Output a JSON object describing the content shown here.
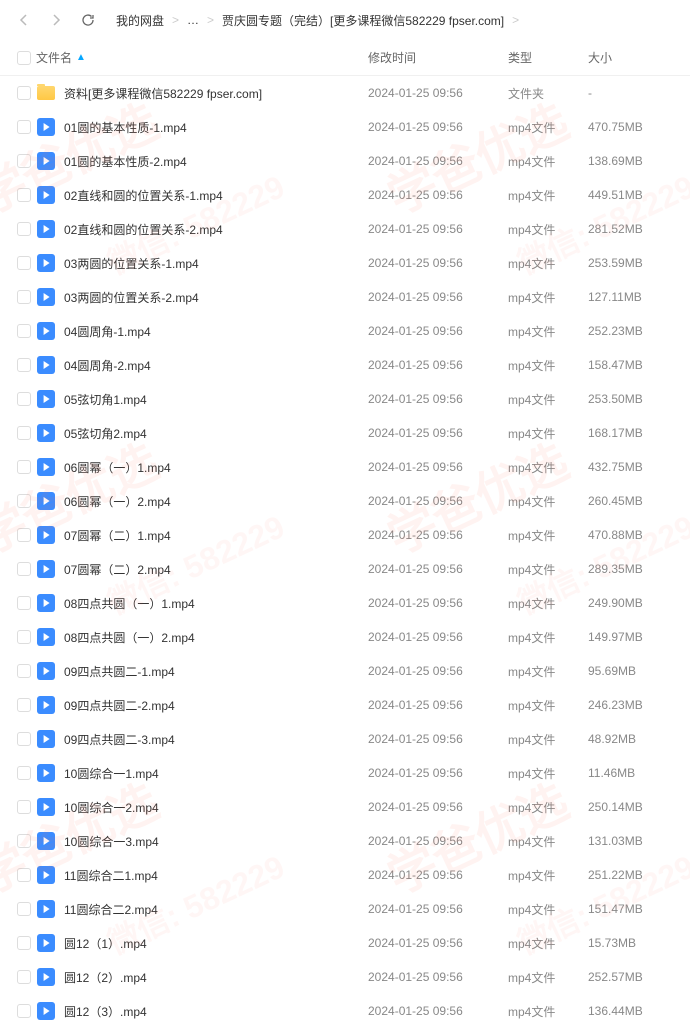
{
  "breadcrumb": {
    "item1": "我的网盘",
    "sep": ">",
    "dots": "…",
    "item2": "贾庆圆专题（完结）[更多课程微信582229 fpser.com]"
  },
  "headers": {
    "name": "文件名",
    "date": "修改时间",
    "type": "类型",
    "size": "大小"
  },
  "watermark": {
    "main": "学爸优选",
    "sub": "微信: 582229"
  },
  "files": [
    {
      "name": "资料[更多课程微信582229 fpser.com]",
      "date": "2024-01-25 09:56",
      "type": "文件夹",
      "size": "-",
      "icon": "folder"
    },
    {
      "name": "01圆的基本性质-1.mp4",
      "date": "2024-01-25 09:56",
      "type": "mp4文件",
      "size": "470.75MB",
      "icon": "video"
    },
    {
      "name": "01圆的基本性质-2.mp4",
      "date": "2024-01-25 09:56",
      "type": "mp4文件",
      "size": "138.69MB",
      "icon": "video"
    },
    {
      "name": "02直线和圆的位置关系-1.mp4",
      "date": "2024-01-25 09:56",
      "type": "mp4文件",
      "size": "449.51MB",
      "icon": "video"
    },
    {
      "name": "02直线和圆的位置关系-2.mp4",
      "date": "2024-01-25 09:56",
      "type": "mp4文件",
      "size": "281.52MB",
      "icon": "video"
    },
    {
      "name": "03两圆的位置关系-1.mp4",
      "date": "2024-01-25 09:56",
      "type": "mp4文件",
      "size": "253.59MB",
      "icon": "video"
    },
    {
      "name": "03两圆的位置关系-2.mp4",
      "date": "2024-01-25 09:56",
      "type": "mp4文件",
      "size": "127.11MB",
      "icon": "video"
    },
    {
      "name": "04圆周角-1.mp4",
      "date": "2024-01-25 09:56",
      "type": "mp4文件",
      "size": "252.23MB",
      "icon": "video"
    },
    {
      "name": "04圆周角-2.mp4",
      "date": "2024-01-25 09:56",
      "type": "mp4文件",
      "size": "158.47MB",
      "icon": "video"
    },
    {
      "name": "05弦切角1.mp4",
      "date": "2024-01-25 09:56",
      "type": "mp4文件",
      "size": "253.50MB",
      "icon": "video"
    },
    {
      "name": "05弦切角2.mp4",
      "date": "2024-01-25 09:56",
      "type": "mp4文件",
      "size": "168.17MB",
      "icon": "video"
    },
    {
      "name": "06圆幂（一）1.mp4",
      "date": "2024-01-25 09:56",
      "type": "mp4文件",
      "size": "432.75MB",
      "icon": "video"
    },
    {
      "name": "06圆幂（一）2.mp4",
      "date": "2024-01-25 09:56",
      "type": "mp4文件",
      "size": "260.45MB",
      "icon": "video"
    },
    {
      "name": "07圆幂（二）1.mp4",
      "date": "2024-01-25 09:56",
      "type": "mp4文件",
      "size": "470.88MB",
      "icon": "video"
    },
    {
      "name": "07圆幂（二）2.mp4",
      "date": "2024-01-25 09:56",
      "type": "mp4文件",
      "size": "289.35MB",
      "icon": "video"
    },
    {
      "name": "08四点共圆（一）1.mp4",
      "date": "2024-01-25 09:56",
      "type": "mp4文件",
      "size": "249.90MB",
      "icon": "video"
    },
    {
      "name": "08四点共圆（一）2.mp4",
      "date": "2024-01-25 09:56",
      "type": "mp4文件",
      "size": "149.97MB",
      "icon": "video"
    },
    {
      "name": "09四点共圆二-1.mp4",
      "date": "2024-01-25 09:56",
      "type": "mp4文件",
      "size": "95.69MB",
      "icon": "video"
    },
    {
      "name": "09四点共圆二-2.mp4",
      "date": "2024-01-25 09:56",
      "type": "mp4文件",
      "size": "246.23MB",
      "icon": "video"
    },
    {
      "name": "09四点共圆二-3.mp4",
      "date": "2024-01-25 09:56",
      "type": "mp4文件",
      "size": "48.92MB",
      "icon": "video"
    },
    {
      "name": "10圆综合一1.mp4",
      "date": "2024-01-25 09:56",
      "type": "mp4文件",
      "size": "11.46MB",
      "icon": "video"
    },
    {
      "name": "10圆综合一2.mp4",
      "date": "2024-01-25 09:56",
      "type": "mp4文件",
      "size": "250.14MB",
      "icon": "video"
    },
    {
      "name": "10圆综合一3.mp4",
      "date": "2024-01-25 09:56",
      "type": "mp4文件",
      "size": "131.03MB",
      "icon": "video"
    },
    {
      "name": "11圆综合二1.mp4",
      "date": "2024-01-25 09:56",
      "type": "mp4文件",
      "size": "251.22MB",
      "icon": "video"
    },
    {
      "name": "11圆综合二2.mp4",
      "date": "2024-01-25 09:56",
      "type": "mp4文件",
      "size": "151.47MB",
      "icon": "video"
    },
    {
      "name": "圆12（1）.mp4",
      "date": "2024-01-25 09:56",
      "type": "mp4文件",
      "size": "15.73MB",
      "icon": "video"
    },
    {
      "name": "圆12（2）.mp4",
      "date": "2024-01-25 09:56",
      "type": "mp4文件",
      "size": "252.57MB",
      "icon": "video"
    },
    {
      "name": "圆12（3）.mp4",
      "date": "2024-01-25 09:56",
      "type": "mp4文件",
      "size": "136.44MB",
      "icon": "video"
    }
  ]
}
